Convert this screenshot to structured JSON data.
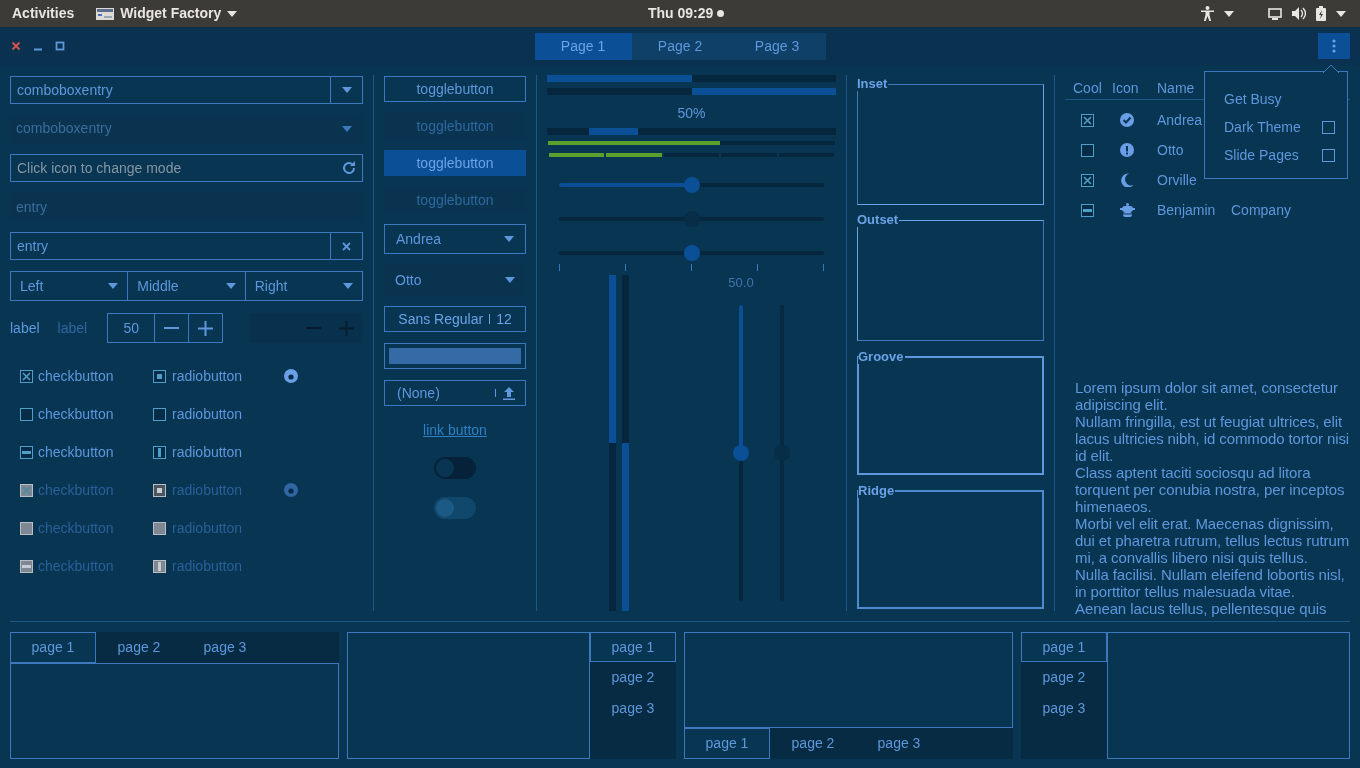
{
  "top_bar": {
    "activities": "Activities",
    "app_menu": "Widget Factory",
    "clock": "Thu 09:29"
  },
  "header_bar": {
    "stack_pages": [
      {
        "label": "Page 1",
        "selected": true
      },
      {
        "label": "Page 2",
        "selected": false
      },
      {
        "label": "Page 3",
        "selected": false
      }
    ]
  },
  "column_1": {
    "combo_entries": [
      {
        "value": "comboboxentry",
        "disabled": false
      },
      {
        "value": "comboboxentry",
        "disabled": true
      }
    ],
    "entries": [
      {
        "kind": "icon",
        "placeholder": "Click icon to change mode",
        "disabled": false
      },
      {
        "kind": "plain",
        "value": "entry",
        "disabled": true
      },
      {
        "kind": "clear",
        "value": "entry",
        "disabled": false
      }
    ],
    "linked_combos": [
      "Left",
      "Middle",
      "Right"
    ],
    "labels": [
      {
        "text": "label",
        "disabled": false
      },
      {
        "text": "label",
        "disabled": true
      }
    ],
    "spin_buttons": [
      {
        "value": "50",
        "disabled": false
      },
      {
        "disabled": true
      }
    ],
    "check_rows": [
      {
        "check": {
          "label": "checkbutton",
          "checked": true,
          "inconsistent": false
        },
        "radio": {
          "label": "radiobutton",
          "checked": true,
          "inconsistent": false
        },
        "disabled": false,
        "extra_radio": true
      },
      {
        "check": {
          "label": "checkbutton",
          "checked": false,
          "inconsistent": false
        },
        "radio": {
          "label": "radiobutton",
          "checked": false,
          "inconsistent": false
        },
        "disabled": false,
        "extra_radio": false
      },
      {
        "check": {
          "label": "checkbutton",
          "checked": false,
          "inconsistent": true
        },
        "radio": {
          "label": "radiobutton",
          "checked": false,
          "inconsistent": true
        },
        "disabled": false,
        "extra_radio": false
      },
      {
        "check": {
          "label": "checkbutton",
          "checked": true,
          "inconsistent": false
        },
        "radio": {
          "label": "radiobutton",
          "checked": true,
          "inconsistent": false
        },
        "disabled": true,
        "extra_radio": true
      },
      {
        "check": {
          "label": "checkbutton",
          "checked": false,
          "inconsistent": false
        },
        "radio": {
          "label": "radiobutton",
          "checked": false,
          "inconsistent": false
        },
        "disabled": true,
        "extra_radio": false
      },
      {
        "check": {
          "label": "checkbutton",
          "checked": false,
          "inconsistent": true
        },
        "radio": {
          "label": "radiobutton",
          "checked": false,
          "inconsistent": true
        },
        "disabled": true,
        "extra_radio": false
      }
    ]
  },
  "column_2": {
    "toggle_buttons": [
      {
        "label": "togglebutton",
        "active": false,
        "disabled": false
      },
      {
        "label": "togglebutton",
        "active": false,
        "disabled": true
      },
      {
        "label": "togglebutton",
        "active": true,
        "disabled": false
      },
      {
        "label": "togglebutton",
        "active": false,
        "disabled": true
      }
    ],
    "combos": [
      {
        "value": "Andrea",
        "kind": "framed"
      },
      {
        "value": "Otto",
        "kind": "flat"
      }
    ],
    "font_button": {
      "family": "Sans Regular",
      "size": "12"
    },
    "color_button": {
      "color": "#346aa6"
    },
    "file_button": {
      "value": "(None)"
    },
    "link_button": "link button",
    "switches": [
      {
        "on": false,
        "disabled": false
      },
      {
        "on": false,
        "disabled": true
      }
    ]
  },
  "column_3": {
    "progress_bars": [
      {
        "level": 0.5,
        "inverted": false
      },
      {
        "level": 0.5,
        "inverted": true
      }
    ],
    "activity_bar": {
      "text": "50%",
      "level": 0.2
    },
    "level_bars": [
      {
        "kind": "continuous",
        "level": 0.6
      },
      {
        "kind": "discrete",
        "level": 0.4
      }
    ],
    "scales": [
      {
        "level": 0.5,
        "disabled": false,
        "marks": false
      },
      {
        "level": 0.5,
        "disabled": true,
        "marks": false
      },
      {
        "level": 0.5,
        "disabled": false,
        "marks": true
      }
    ],
    "vertical_progress_bars": [
      {
        "level": 0.5,
        "inverted": false
      },
      {
        "level": 0.5,
        "inverted": true
      }
    ],
    "vertical_scales": [
      {
        "level": 0.5,
        "value": "50.0",
        "disabled": false
      },
      {
        "level": 0.5,
        "disabled": true
      }
    ]
  },
  "column_4": {
    "frames": [
      {
        "label": "Inset",
        "kind": "inset"
      },
      {
        "label": "Outset",
        "kind": "outset"
      },
      {
        "label": "Groove",
        "kind": "groove"
      },
      {
        "label": "Ridge",
        "kind": "ridge"
      }
    ]
  },
  "column_5": {
    "table": {
      "columns": [
        "Cool",
        "Icon",
        "Name"
      ],
      "rows": [
        {
          "cool": {
            "checked": true,
            "inconsistent": false
          },
          "kind": "check",
          "name": "Andrea"
        },
        {
          "cool": {
            "checked": false,
            "inconsistent": false
          },
          "kind": "alert",
          "name": "Otto"
        },
        {
          "cool": {
            "checked": true,
            "inconsistent": false
          },
          "kind": "moon",
          "name": "Orville"
        },
        {
          "cool": {
            "checked": false,
            "inconsistent": true
          },
          "kind": "emblem",
          "name": "Benjamin",
          "nick": "Company"
        }
      ]
    },
    "text_view": [
      "Lorem ipsum dolor sit amet, consectetur adipiscing elit.",
      "Nullam fringilla, est ut feugiat ultrices, elit lacus ultricies nibh, id commodo tortor nisi id elit.",
      "Class aptent taciti sociosqu ad litora torquent per conubia nostra, per inceptos himenaeos.",
      "Morbi vel elit erat. Maecenas dignissim, dui et pharetra rutrum, tellus lectus rutrum mi, a convallis libero nisi quis tellus.",
      "Nulla facilisi. Nullam eleifend lobortis nisl, in porttitor tellus malesuada vitae.",
      "Aenean lacus tellus, pellentesque quis"
    ]
  },
  "popover": {
    "items": [
      {
        "label": "Get Busy",
        "kind": "action"
      },
      {
        "label": "Dark Theme",
        "kind": "check",
        "checked": false
      },
      {
        "label": "Slide Pages",
        "kind": "check",
        "checked": false
      }
    ]
  },
  "notebooks": [
    {
      "kind": "top",
      "tabs": [
        {
          "label": "page 1",
          "selected": true
        },
        {
          "label": "page 2",
          "selected": false
        },
        {
          "label": "page 3",
          "selected": false
        }
      ]
    },
    {
      "kind": "right",
      "tabs": [
        {
          "label": "page 1",
          "selected": true
        },
        {
          "label": "page 2",
          "selected": false
        },
        {
          "label": "page 3",
          "selected": false
        }
      ]
    },
    {
      "kind": "bottom",
      "tabs": [
        {
          "label": "page 1",
          "selected": true
        },
        {
          "label": "page 2",
          "selected": false
        },
        {
          "label": "page 3",
          "selected": false
        }
      ]
    },
    {
      "kind": "left",
      "tabs": [
        {
          "label": "page 1",
          "selected": true
        },
        {
          "label": "page 2",
          "selected": false
        },
        {
          "label": "page 3",
          "selected": false
        }
      ]
    }
  ]
}
